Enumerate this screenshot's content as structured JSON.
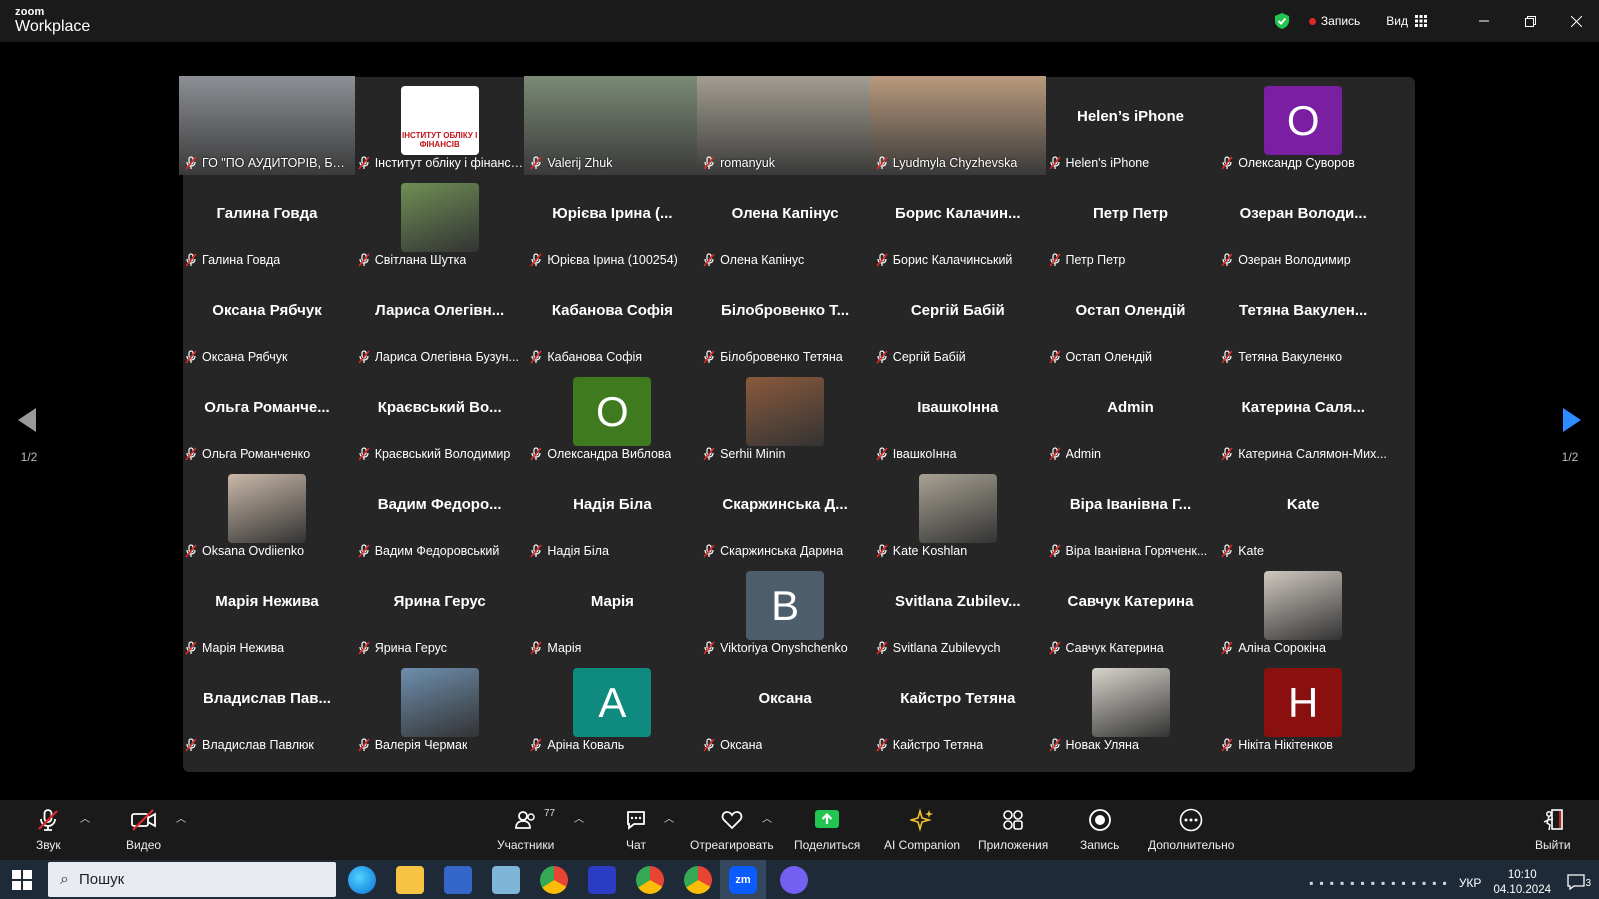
{
  "app": {
    "brand_top": "zoom",
    "brand_bottom": "Workplace"
  },
  "titlebar": {
    "record_label": "Запись",
    "view_label": "Вид"
  },
  "gallery": {
    "rows": [
      [
        {
          "big": "",
          "name": "ГО \"ПО АУДИТОРІВ, БУХГАЛ...",
          "kind": "video",
          "active": true,
          "bg": "#8c8f94"
        },
        {
          "big": "",
          "name": "Інститут обліку і фінансі...",
          "kind": "logo",
          "logo_text": "ІНСТИТУТ ОБЛІКУ І ФІНАНСІВ"
        },
        {
          "big": "",
          "name": "Valerij Zhuk",
          "kind": "video",
          "bg": "#7b8a76"
        },
        {
          "big": "",
          "name": "romanyuk",
          "kind": "video",
          "bg": "#a39e92"
        },
        {
          "big": "",
          "name": "Lyudmyla Chyzhevska",
          "kind": "video",
          "bg": "#b99a7c"
        },
        {
          "big": "Helen’s iPhone",
          "name": "Helen's iPhone",
          "kind": "text"
        },
        {
          "big": "",
          "name": "Олександр Суворов",
          "kind": "avatar",
          "letter": "О",
          "color": "#7a1fa2"
        }
      ],
      [
        {
          "big": "Галина Говда",
          "name": "Галина Говда",
          "kind": "text"
        },
        {
          "big": "",
          "name": "Світлана Шутка",
          "kind": "photo",
          "bg": "#6f8f55"
        },
        {
          "big": "Юрієва Ірина (...",
          "name": "Юрієва Ірина (100254)",
          "kind": "text"
        },
        {
          "big": "Олена Капінус",
          "name": "Олена Капінус",
          "kind": "text"
        },
        {
          "big": "Борис Калачин...",
          "name": "Борис Калачинський",
          "kind": "text"
        },
        {
          "big": "Петр Петр",
          "name": "Петр Петр",
          "kind": "text"
        },
        {
          "big": "Озеран Володи...",
          "name": "Озеран Володимир",
          "kind": "text"
        }
      ],
      [
        {
          "big": "Оксана Рябчук",
          "name": "Оксана Рябчук",
          "kind": "text"
        },
        {
          "big": "Лариса Олегівн...",
          "name": "Лариса Олегівна Бузун...",
          "kind": "text"
        },
        {
          "big": "Кабанова Софія",
          "name": "Кабанова Софія",
          "kind": "text"
        },
        {
          "big": "Білобровенко Т...",
          "name": "Білобровенко Тетяна",
          "kind": "text"
        },
        {
          "big": "Сергій Бабій",
          "name": "Сергій Бабій",
          "kind": "text"
        },
        {
          "big": "Остап Олендій",
          "name": "Остап Олендій",
          "kind": "text"
        },
        {
          "big": "Тетяна Вакулен...",
          "name": "Тетяна Вакуленко",
          "kind": "text"
        }
      ],
      [
        {
          "big": "Ольга Романче...",
          "name": "Ольга Романченко",
          "kind": "text"
        },
        {
          "big": "Краєвський Во...",
          "name": "Краєвський Володимир",
          "kind": "text"
        },
        {
          "big": "",
          "name": "Олександра Виблова",
          "kind": "avatar",
          "letter": "О",
          "color": "#3f7a1e"
        },
        {
          "big": "",
          "name": "Serhii Minin",
          "kind": "photo",
          "bg": "#8a5a3c"
        },
        {
          "big": "ІвашкоІнна",
          "name": "ІвашкоІнна",
          "kind": "text"
        },
        {
          "big": "Admin",
          "name": "Admin",
          "kind": "text"
        },
        {
          "big": "Катерина Саля...",
          "name": "Катерина Салямон-Мих...",
          "kind": "text"
        }
      ],
      [
        {
          "big": "",
          "name": "Oksana Ovdiienko",
          "kind": "photo",
          "bg": "#c9b8a8"
        },
        {
          "big": "Вадим Федоро...",
          "name": "Вадим Федоровський",
          "kind": "text"
        },
        {
          "big": "Надія Біла",
          "name": "Надія Біла",
          "kind": "text"
        },
        {
          "big": "Скаржинська Д...",
          "name": "Скаржинська Дарина",
          "kind": "text"
        },
        {
          "big": "",
          "name": "Kate Koshlan",
          "kind": "photo",
          "bg": "#a8a294"
        },
        {
          "big": "Віра Іванівна Г...",
          "name": "Віра Іванівна Горяченк...",
          "kind": "text"
        },
        {
          "big": "Kate",
          "name": "Kate",
          "kind": "text"
        }
      ],
      [
        {
          "big": "Марія Нежива",
          "name": "Марія Нежива",
          "kind": "text"
        },
        {
          "big": "Ярина Герус",
          "name": "Ярина Герус",
          "kind": "text"
        },
        {
          "big": "Марія",
          "name": "Марія",
          "kind": "text"
        },
        {
          "big": "",
          "name": "Viktoriya Onyshchenko",
          "kind": "avatar",
          "letter": "B",
          "color": "#4d5d6c"
        },
        {
          "big": "Svitlana Zubilev...",
          "name": "Svitlana Zubilevych",
          "kind": "text"
        },
        {
          "big": "Савчук Катерина",
          "name": "Савчук Катерина",
          "kind": "text"
        },
        {
          "big": "",
          "name": "Аліна Сорокіна",
          "kind": "photo",
          "bg": "#cfc8c0"
        }
      ],
      [
        {
          "big": "Владислав Пав...",
          "name": "Владислав Павлюк",
          "kind": "text"
        },
        {
          "big": "",
          "name": "Валерія Чермак",
          "kind": "photo",
          "bg": "#6e8fae"
        },
        {
          "big": "",
          "name": "Аріна Коваль",
          "kind": "avatar",
          "letter": "A",
          "color": "#0e8a7e"
        },
        {
          "big": "Оксана",
          "name": "Оксана",
          "kind": "text"
        },
        {
          "big": "Кайстро Тетяна",
          "name": "Кайстро Тетяна",
          "kind": "text"
        },
        {
          "big": "",
          "name": "Новак Уляна",
          "kind": "photo",
          "bg": "#d8d4cc"
        },
        {
          "big": "",
          "name": "Нікіта Нікітенков",
          "kind": "avatar",
          "letter": "H",
          "color": "#8a1010"
        }
      ]
    ]
  },
  "pager": {
    "left": "1/2",
    "right": "1/2"
  },
  "toolbar": {
    "audio": "Звук",
    "video": "Видео",
    "participants": "Участники",
    "participants_count": "77",
    "chat": "Чат",
    "react": "Отреагировать",
    "share": "Поделиться",
    "companion": "AI Companion",
    "apps": "Приложения",
    "record": "Запись",
    "more": "Дополнительно",
    "leave": "Выйти"
  },
  "taskbar": {
    "search_placeholder": "Пошук",
    "lang": "УКР",
    "time": "10:10",
    "date": "04.10.2024",
    "notif_count": "3"
  },
  "colors": {
    "accent": "#23d959",
    "share": "#23c552",
    "leave": "#e02828",
    "mic_off": "#e02828"
  }
}
